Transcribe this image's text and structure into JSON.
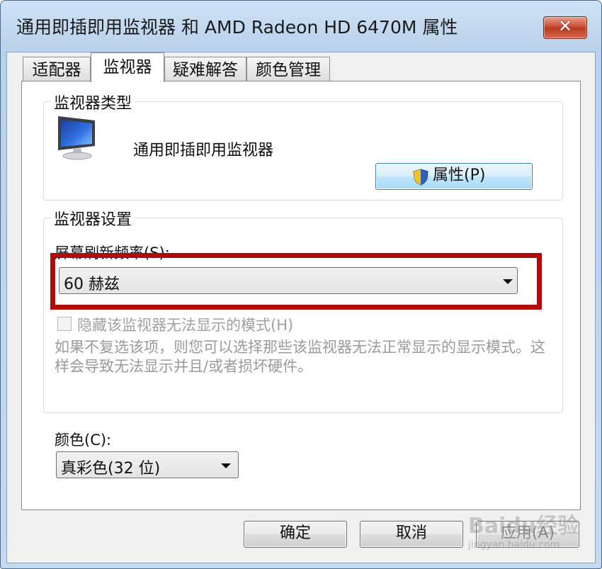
{
  "window": {
    "title": "通用即插即用监视器 和 AMD Radeon HD 6470M 属性",
    "close_label": "✕"
  },
  "tabs": [
    {
      "label": "适配器",
      "active": false
    },
    {
      "label": "监视器",
      "active": true
    },
    {
      "label": "疑难解答",
      "active": false
    },
    {
      "label": "颜色管理",
      "active": false
    }
  ],
  "monitor_type": {
    "group_label": "监视器类型",
    "monitor_name": "通用即插即用监视器",
    "properties_button": "属性(P)"
  },
  "monitor_settings": {
    "group_label": "监视器设置",
    "refresh_label": "屏幕刷新频率(S):",
    "refresh_value": "60 赫兹",
    "hide_modes_label": "隐藏该监视器无法显示的模式(H)",
    "hide_modes_checked": false,
    "help_text": "如果不复选该项，则您可以选择那些该监视器无法正常显示的显示模式。这样会导致无法显示并且/或者损坏硬件。"
  },
  "color": {
    "label": "颜色(C):",
    "value": "真彩色(32 位)"
  },
  "buttons": {
    "ok": "确定",
    "cancel": "取消",
    "apply": "应用(A)"
  },
  "watermark": {
    "text": "Baidu经验",
    "sub": "jingyan.baidu.com"
  },
  "colors": {
    "highlight_border": "#b00a0a",
    "close_button": "#c9492f"
  }
}
